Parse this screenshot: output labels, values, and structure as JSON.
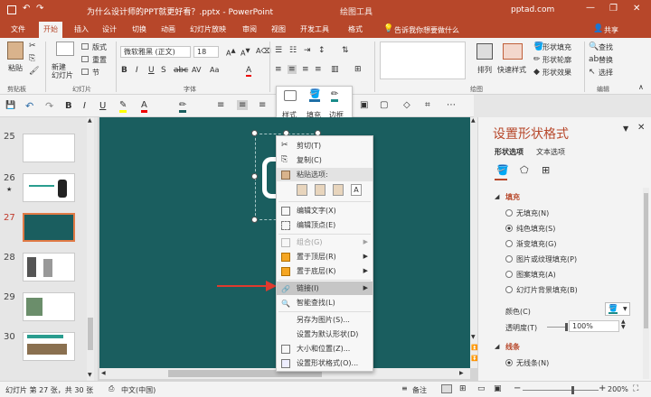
{
  "titlebar": {
    "title": "为什么设计师的PPT就更好看？.pptx - PowerPoint",
    "context": "绘图工具",
    "account": "pptad.com"
  },
  "tabs": [
    {
      "label": "文件"
    },
    {
      "label": "开始"
    },
    {
      "label": "插入"
    },
    {
      "label": "设计"
    },
    {
      "label": "切换"
    },
    {
      "label": "动画"
    },
    {
      "label": "幻灯片放映"
    },
    {
      "label": "审阅"
    },
    {
      "label": "视图"
    },
    {
      "label": "开发工具"
    },
    {
      "label": "格式"
    }
  ],
  "tell_me": "告诉我你想要做什么",
  "share": "共享",
  "ribbon": {
    "paste": "粘贴",
    "new_slide": "新建\n幻灯片",
    "layout": "版式",
    "reset": "重置",
    "section": "节",
    "font_name": "微软雅黑 (正文)",
    "font_size": "18",
    "shape_fill": "形状填充",
    "shape_outline": "形状轮廓",
    "shape_effect": "形状效果",
    "arrange": "排列",
    "quick_styles": "快速样式",
    "find": "查找",
    "replace": "替换",
    "select": "选择",
    "groups": {
      "clipboard": "剪贴板",
      "slides": "幻灯片",
      "font": "字体",
      "paragraph": "段落",
      "drawing": "绘图",
      "editing": "编辑"
    }
  },
  "mini_toolbar": {
    "font_name": "微软雅黑 (正文)",
    "font_size": "18",
    "style": "样式",
    "fill": "填充",
    "outline": "边框"
  },
  "slides": [
    {
      "num": "25"
    },
    {
      "num": "26"
    },
    {
      "num": "27"
    },
    {
      "num": "28"
    },
    {
      "num": "29"
    },
    {
      "num": "30"
    }
  ],
  "context_menu": {
    "cut": "剪切(T)",
    "copy": "复制(C)",
    "paste_options": "粘贴选项:",
    "edit_text": "编辑文字(X)",
    "edit_points": "编辑顶点(E)",
    "group": "组合(G)",
    "bring_front": "置于顶层(R)",
    "send_back": "置于底层(K)",
    "link": "链接(I)",
    "smart_lookup": "智能查找(L)",
    "save_as_picture": "另存为图片(S)...",
    "set_default": "设置为默认形状(D)",
    "size_position": "大小和位置(Z)...",
    "format_shape": "设置形状格式(O)..."
  },
  "format_panel": {
    "title": "设置形状格式",
    "tabs": [
      "形状选项",
      "文本选项"
    ],
    "fill_section": "填充",
    "fill_options": [
      "无填充(N)",
      "纯色填充(S)",
      "渐变填充(G)",
      "图片或纹理填充(P)",
      "图案填充(A)",
      "幻灯片背景填充(B)"
    ],
    "selected_fill": 1,
    "color_label": "颜色(C)",
    "transparency_label": "透明度(T)",
    "transparency_value": "100%",
    "line_section": "线条",
    "line_option": "无线条(N)"
  },
  "statusbar": {
    "slide_info": "幻灯片 第 27 张，共 30 张",
    "language": "中文(中国)",
    "notes": "备注",
    "zoom": "200%"
  },
  "colors": {
    "accent": "#b7472a",
    "slide_bg": "#1a5e5f",
    "arrow": "#e03a2e"
  }
}
